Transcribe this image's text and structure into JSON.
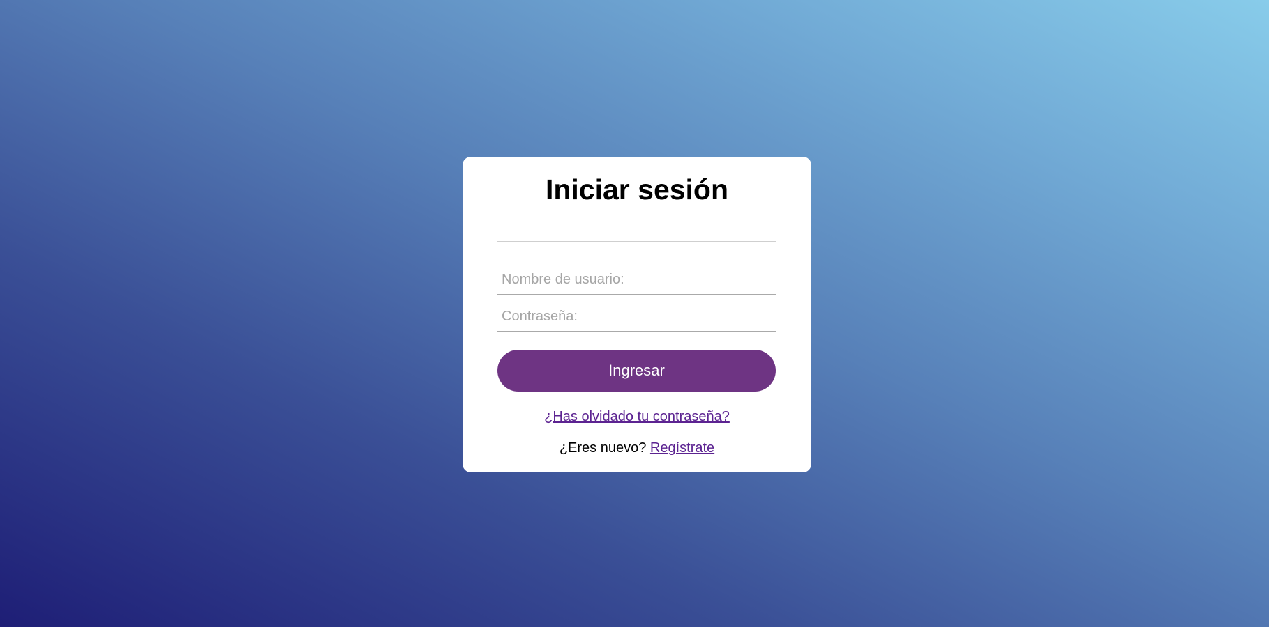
{
  "login": {
    "title": "Iniciar sesión",
    "username_placeholder": "Nombre de usuario:",
    "password_placeholder": "Contraseña:",
    "submit_label": "Ingresar",
    "forgot_link": "¿Has olvidado tu contraseña?",
    "new_user_text": "¿Eres nuevo?",
    "register_link": "Regístrate"
  },
  "colors": {
    "button": "#6e3483",
    "link": "#5c2391",
    "gradient_start": "#1e1e76",
    "gradient_end": "#88ccea"
  }
}
